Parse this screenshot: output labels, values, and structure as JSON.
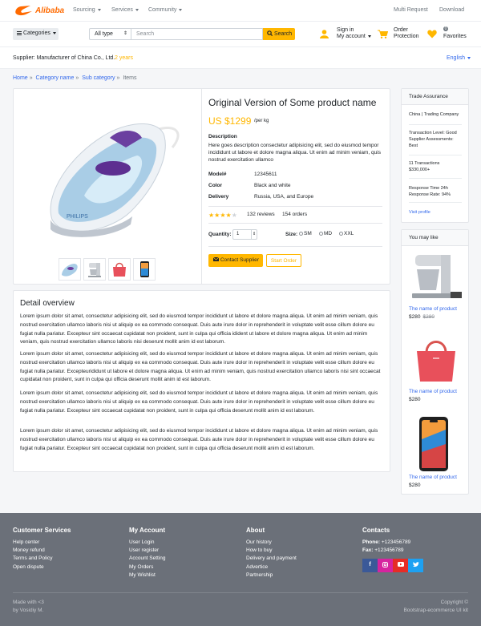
{
  "nav": {
    "logo": "Alibaba",
    "menu": [
      "Sourcing",
      "Services",
      "Community"
    ],
    "right": [
      "Multi Request",
      "Download"
    ]
  },
  "header": {
    "categories": "Categories",
    "search_type": "All type",
    "search_placeholder": "Search",
    "search_button": "Search",
    "signin": "Sign in",
    "my_account": "My account",
    "order": "Order",
    "protection": "Protection",
    "favorites_count": "0",
    "favorites": "Favorites"
  },
  "supplier": {
    "label": "Supplier: Manufacturer of China Co., Ltd.",
    "years": "2 years",
    "language": "English"
  },
  "breadcrumb": [
    "Home",
    "Category name",
    "Sub category",
    "Items"
  ],
  "product": {
    "title": "Original Version of Some product name",
    "price": "US $1299",
    "unit": "/per kg",
    "description_heading": "Description",
    "description": "Here goes description consectetur adipisicing elit, sed do eiusmod tempor incididunt ut labore et dolore magna aliqua. Ut enim ad minim veniam, quis nostrud exercitation ullamco",
    "specs": [
      {
        "k": "Model#",
        "v": "12345611"
      },
      {
        "k": "Color",
        "v": "Black and white"
      },
      {
        "k": "Delivery",
        "v": "Russia, USA, and Europe"
      }
    ],
    "rating": 4,
    "reviews": "132 reviews",
    "orders": "154 orders",
    "quantity_label": "Quantity:",
    "quantity_value": "1",
    "size_label": "Size:",
    "sizes": [
      "SM",
      "MD",
      "XXL"
    ],
    "contact_button": "Contact Supplier",
    "start_order_button": "Start Order"
  },
  "detail": {
    "title": "Detail overview",
    "paragraphs": [
      "Lorem ipsum dolor sit amet, consectetur adipisicing elit, sed do eiusmod tempor incididunt ut labore et dolore magna aliqua. Ut enim ad minim veniam, quis nostrud exercitation ullamco laboris nisi ut aliquip ex ea commodo consequat. Duis aute irure dolor in reprehenderit in voluptate velit esse cillum dolore eu fugiat nulla pariatur. Excepteur sint occaecat cupidatat non proident, sunt in culpa qui officia idident ut labore et dolore magna aliqua. Ut enim ad minim veniam, quis nostrud exercitation ullamco laboris nisi deserunt mollit anim id est laborum.",
      "Lorem ipsum dolor sit amet, consectetur adipisicing elit, sed do eiusmod tempor incididunt ut labore et dolore magna aliqua. Ut enim ad minim veniam, quis nostrud exercitation ullamco laboris nisi ut aliquip ex ea commodo consequat. Duis aute irure dolor in reprehenderit in voluptate velit esse cillum dolore eu fugiat nulla pariatur. Excepteurididunt ut labore et dolore magna aliqua. Ut enim ad minim veniam, quis nostrud exercitation ullamco laboris nisi sint occaecat cupidatat non proident, sunt in culpa qui officia deserunt mollit anim id est laborum.",
      "Lorem ipsum dolor sit amet, consectetur adipisicing elit, sed do eiusmod tempor incididunt ut labore et dolore magna aliqua. Ut enim ad minim veniam, quis nostrud exercitation ullamco laboris nisi ut aliquip ex ea commodo consequat. Duis aute irure dolor in reprehenderit in voluptate velit esse cillum dolore eu fugiat nulla pariatur. Excepteur sint occaecat cupidatat non proident, sunt in culpa qui officia deserunt mollit anim id est laborum.",
      "Lorem ipsum dolor sit amet, consectetur adipisicing elit, sed do eiusmod tempor incididunt ut labore et dolore magna aliqua. Ut enim ad minim veniam, quis nostrud exercitation ullamco laboris nisi ut aliquip ex ea commodo consequat. Duis aute irure dolor in reprehenderit in voluptate velit esse cillum dolore eu fugiat nulla pariatur. Excepteur sint occaecat cupidatat non proident, sunt in culpa qui officia deserunt mollit anim id est laborum."
    ]
  },
  "trade": {
    "title": "Trade Assurance",
    "items": [
      [
        "China | Trading Company"
      ],
      [
        "Transaction Level: Good",
        "Supplier Assessments:",
        "Best"
      ],
      [
        "11 Transactions",
        "$330,000+"
      ],
      [
        "Response Time 24h",
        "Response Rate: 94%"
      ]
    ],
    "link": "Visit profile"
  },
  "may_like": {
    "title": "You may like",
    "items": [
      {
        "name": "The name of product",
        "price": "$280",
        "old": "$280"
      },
      {
        "name": "The name of product",
        "price": "$280",
        "old": ""
      },
      {
        "name": "The name of product",
        "price": "$280",
        "old": ""
      }
    ]
  },
  "footer": {
    "columns": [
      {
        "title": "Customer Services",
        "items": [
          "Help center",
          "Money refund",
          "Terms and Policy",
          "Open dispute"
        ]
      },
      {
        "title": "My Account",
        "items": [
          "User Login",
          "User register",
          "Account Setting",
          "My Orders",
          "My Wishlist"
        ]
      },
      {
        "title": "About",
        "items": [
          "Our history",
          "How to buy",
          "Delivery and payment",
          "Advertice",
          "Partnership"
        ]
      }
    ],
    "contacts_title": "Contacts",
    "phone_label": "Phone:",
    "phone": "+123456789",
    "fax_label": "Fax:",
    "fax": "+123456789",
    "made_with": "Made with <3",
    "made_by": "by Vosidiy M.",
    "copyright": "Copyright ©",
    "kit": "Bootstrap-ecommerce UI kit"
  },
  "colors": {
    "accent": "#ffb700",
    "link": "#3167eb",
    "footer": "#6b7079"
  }
}
